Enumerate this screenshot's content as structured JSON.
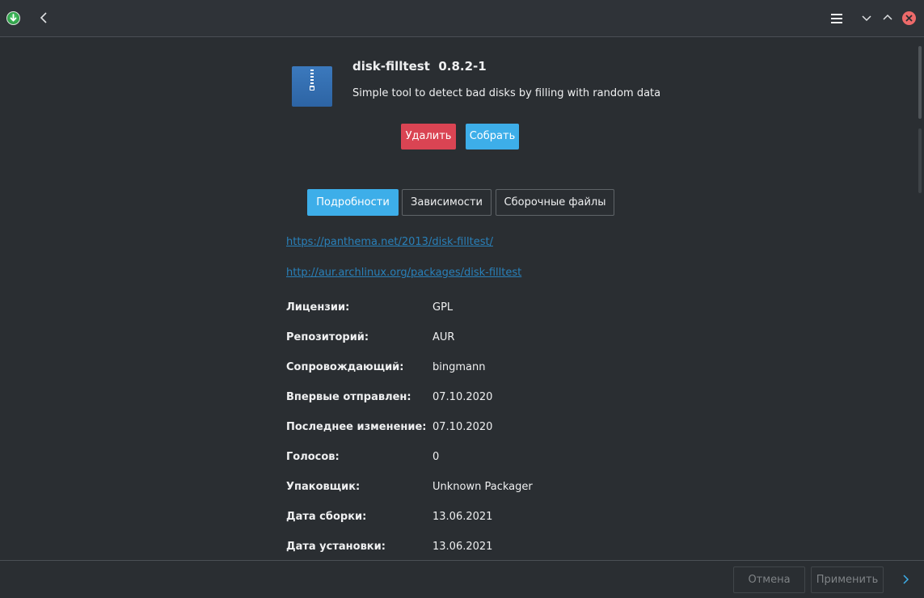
{
  "package": {
    "name": "disk-filltest",
    "version": "0.8.2-1",
    "description": "Simple tool to detect bad disks by filling with random data"
  },
  "actions": {
    "remove_label": "Удалить",
    "build_label": "Собрать"
  },
  "tabs": [
    {
      "label": "Подробности",
      "active": true
    },
    {
      "label": "Зависимости",
      "active": false
    },
    {
      "label": "Сборочные файлы",
      "active": false
    }
  ],
  "links": [
    "https://panthema.net/2013/disk-filltest/",
    "http://aur.archlinux.org/packages/disk-filltest"
  ],
  "properties": [
    {
      "label": "Лицензии:",
      "value": "GPL"
    },
    {
      "label": "Репозиторий:",
      "value": "AUR"
    },
    {
      "label": "Сопровождающий:",
      "value": "bingmann"
    },
    {
      "label": "Впервые отправлен:",
      "value": "07.10.2020"
    },
    {
      "label": "Последнее изменение:",
      "value": "07.10.2020"
    },
    {
      "label": "Голосов:",
      "value": "0"
    },
    {
      "label": "Упаковщик:",
      "value": "Unknown Packager"
    },
    {
      "label": "Дата сборки:",
      "value": "13.06.2021"
    },
    {
      "label": "Дата установки:",
      "value": "13.06.2021"
    }
  ],
  "footer": {
    "cancel_label": "Отмена",
    "apply_label": "Применить"
  },
  "colors": {
    "accent": "#3daee9",
    "danger": "#da4453",
    "link": "#2980b9",
    "background": "#2a2e32"
  },
  "icons": {
    "app": "pamac-icon",
    "back": "chevron-left-icon",
    "menu": "hamburger-menu-icon",
    "minimize": "chevron-down-icon",
    "maximize": "chevron-up-icon",
    "close": "close-icon",
    "package": "zip-archive-icon",
    "next": "chevron-right-icon"
  }
}
